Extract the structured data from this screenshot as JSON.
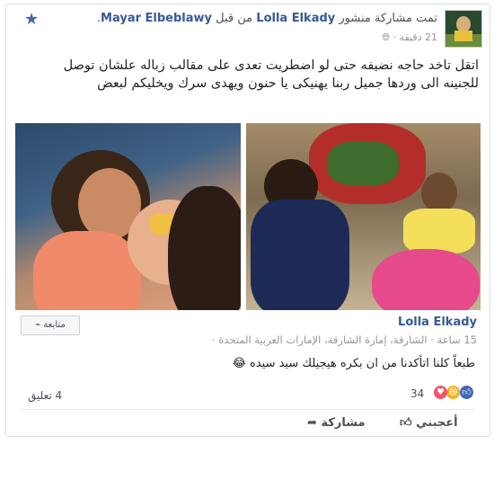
{
  "header": {
    "sharer": "Mayar Elbeblawy",
    "verb_part1": "تمت مشاركة منشور",
    "original_author": "Lolla Elkady",
    "verb_part2": "من قبل",
    "time": "21 دقيقة ·",
    "audience_icon": "globe-icon"
  },
  "post_text": "اتقل تاخد حاجه نضيفه حتى لو اضطريت تعدى على مقالب زباله علشان توصل للجنينه الى وردها جميل ربنا يهنيكى يا حنون ويهدى سرك ويخليكم لبعض",
  "shared_post": {
    "author": "Lolla Elkady",
    "meta": "15 ساعة · الشارقة، إمارة الشارقة، الإمارات العربية المتحدة ·",
    "follow_label": "متابعة",
    "text": "طبعاً كلنا اتأكدنا من ان بكره هيجيلك سيد سيده 😂"
  },
  "stats": {
    "reactions_count": "34",
    "comments": "4 تعليق"
  },
  "actions": {
    "like": "أعجبني",
    "share": "مشاركة"
  },
  "colors": {
    "link": "#365899",
    "like_blue": "#4267b2",
    "love_red": "#f25268",
    "haha_yellow": "#f7b125"
  }
}
